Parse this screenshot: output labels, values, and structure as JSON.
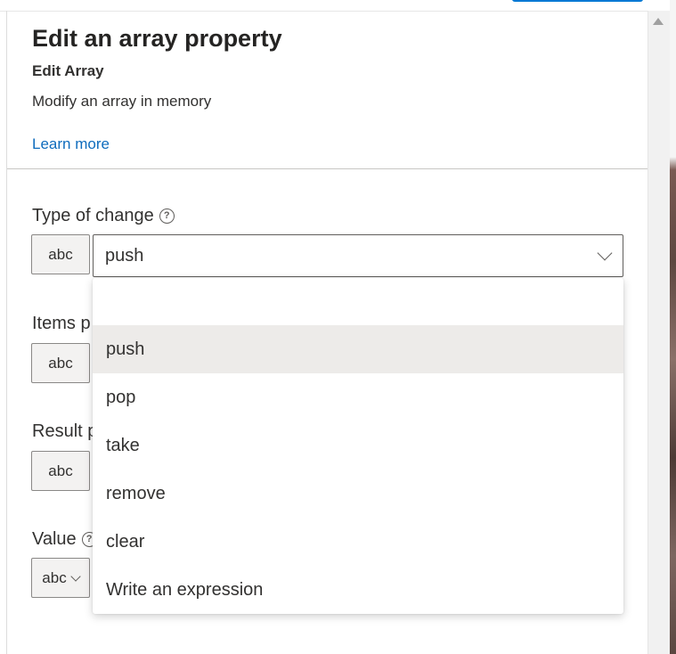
{
  "panel": {
    "title": "Edit an array property",
    "subtitle": "Edit Array",
    "description": "Modify an array in memory",
    "learn_more": "Learn more"
  },
  "fields": {
    "type_of_change": {
      "label": "Type of change",
      "help_icon": "?",
      "type_badge": "abc",
      "value": "push"
    },
    "items_property": {
      "label_visible": "Items p",
      "type_badge": "abc"
    },
    "result_property": {
      "label_visible": "Result p",
      "type_badge": "abc"
    },
    "value": {
      "label": "Value",
      "help_icon": "?",
      "type_badge": "abc"
    }
  },
  "dropdown": {
    "selected": "push",
    "options": [
      "",
      "push",
      "pop",
      "take",
      "remove",
      "clear",
      "Write an expression"
    ]
  },
  "colors": {
    "link": "#0f6cbd",
    "selected_option_bg": "#edebe9",
    "badge_bg": "#f3f2f1"
  },
  "icons": {
    "help": "question-circle-icon",
    "dropdown": "chevron-down-icon",
    "scroll_up": "caret-up-icon"
  }
}
